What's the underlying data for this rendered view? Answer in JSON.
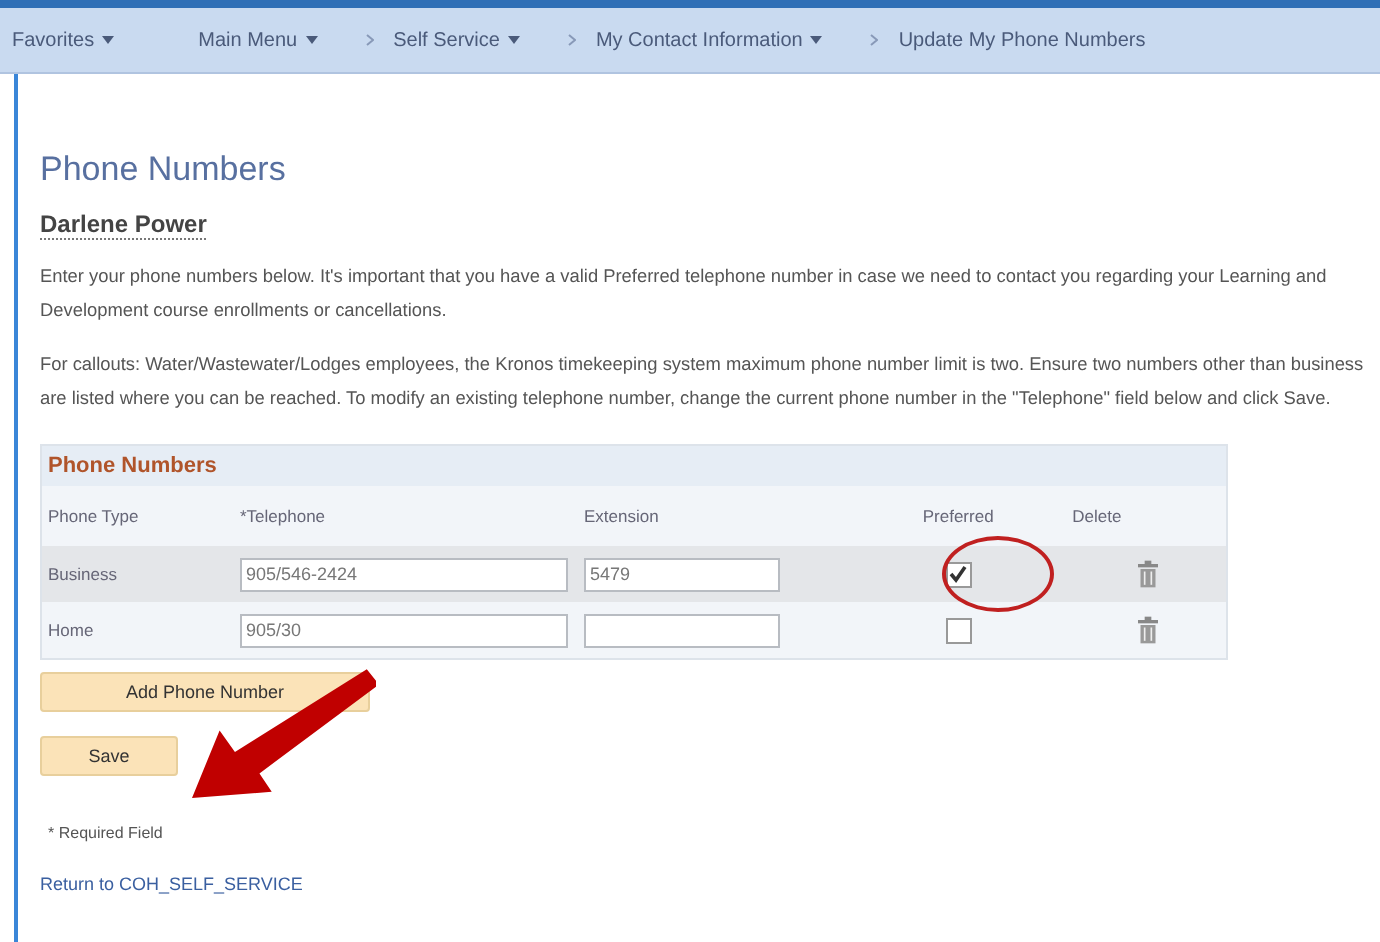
{
  "breadcrumbs": [
    {
      "label": "Favorites",
      "menu": true
    },
    {
      "label": "Main Menu",
      "menu": true
    },
    {
      "label": "Self Service",
      "menu": true
    },
    {
      "label": "My Contact Information",
      "menu": true
    },
    {
      "label": "Update My Phone Numbers",
      "menu": false
    }
  ],
  "page_title": "Phone Numbers",
  "person_name": "Darlene Power",
  "paragraphs": [
    "Enter your phone numbers below.  It's important that you have a valid Preferred telephone number in case we need to contact you regarding your Learning and Development course enrollments or cancellations.",
    "For callouts: Water/Wastewater/Lodges employees, the Kronos timekeeping system maximum phone number limit is two.  Ensure two numbers other than business are listed where you can be reached.  To modify an existing telephone number, change the current phone number in the \"Telephone\" field below and click Save."
  ],
  "grid": {
    "title": "Phone Numbers",
    "columns": [
      "Phone Type",
      "*Telephone",
      "Extension",
      "Preferred",
      "Delete"
    ],
    "rows": [
      {
        "phone_type": "Business",
        "telephone": "905/546-2424",
        "extension": "5479",
        "preferred": true
      },
      {
        "phone_type": "Home",
        "telephone": "905/30",
        "extension": "",
        "preferred": false
      }
    ]
  },
  "buttons": [
    "Add Phone Number",
    "Save"
  ],
  "required_note": "* Required Field",
  "return_link": "Return to COH_SELF_SERVICE"
}
